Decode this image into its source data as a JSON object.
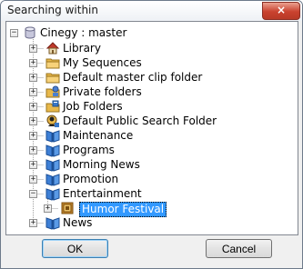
{
  "window": {
    "title": "Searching within",
    "close_glyph": "×"
  },
  "tree": {
    "root": {
      "label": "Cinegy : master",
      "icon": "database-icon",
      "expander": "−"
    },
    "items": [
      {
        "label": "Library",
        "icon": "library-house-icon",
        "expander": "+"
      },
      {
        "label": "My Sequences",
        "icon": "folder-icon",
        "expander": "+"
      },
      {
        "label": "Default master clip folder",
        "icon": "folder-icon",
        "expander": "+"
      },
      {
        "label": "Private folders",
        "icon": "private-folder-icon",
        "expander": "+"
      },
      {
        "label": "Job Folders",
        "icon": "job-folder-icon",
        "expander": "+"
      },
      {
        "label": "Default Public Search Folder",
        "icon": "search-folder-icon",
        "expander": "+"
      },
      {
        "label": "Maintenance",
        "icon": "program-book-icon",
        "expander": "+"
      },
      {
        "label": "Programs",
        "icon": "program-book-icon",
        "expander": "+"
      },
      {
        "label": "Morning News",
        "icon": "program-book-icon",
        "expander": "+"
      },
      {
        "label": "Promotion",
        "icon": "program-book-icon",
        "expander": "+"
      },
      {
        "label": "Entertainment",
        "icon": "program-book-icon",
        "expander": "−"
      },
      {
        "label": "Humor Festival",
        "icon": "bin-icon",
        "expander": "+",
        "child": true,
        "selected": true
      },
      {
        "label": "News",
        "icon": "program-book-icon",
        "expander": "+"
      }
    ]
  },
  "buttons": {
    "ok_label": "OK",
    "cancel_label": "Cancel"
  }
}
